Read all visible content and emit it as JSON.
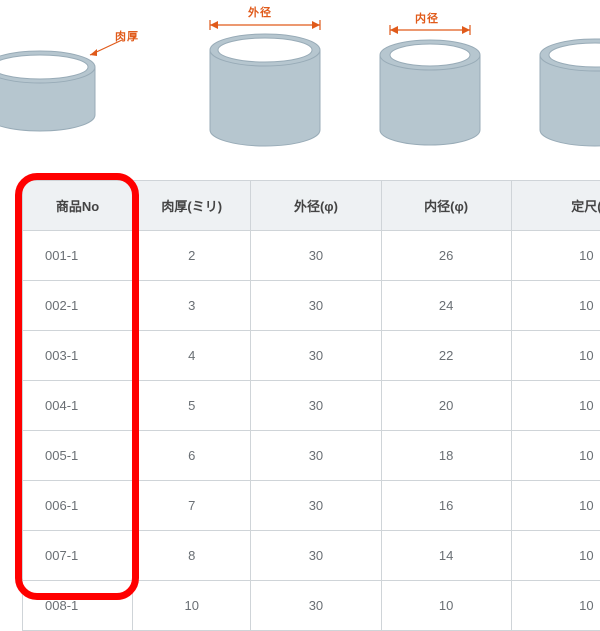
{
  "illustration": {
    "labels": {
      "nikuatsu": "肉厚",
      "gaikei": "外径",
      "naikei": "内径"
    }
  },
  "table": {
    "headers": {
      "product_no": "商品No",
      "thickness": "肉厚(ミリ)",
      "outer_dia": "外径(φ)",
      "inner_dia": "内径(φ)",
      "fixed_len": "定尺("
    },
    "rows": [
      {
        "no": "001-1",
        "thickness": "2",
        "outer": "30",
        "inner": "26",
        "fixed": "10"
      },
      {
        "no": "002-1",
        "thickness": "3",
        "outer": "30",
        "inner": "24",
        "fixed": "10"
      },
      {
        "no": "003-1",
        "thickness": "4",
        "outer": "30",
        "inner": "22",
        "fixed": "10"
      },
      {
        "no": "004-1",
        "thickness": "5",
        "outer": "30",
        "inner": "20",
        "fixed": "10"
      },
      {
        "no": "005-1",
        "thickness": "6",
        "outer": "30",
        "inner": "18",
        "fixed": "10"
      },
      {
        "no": "006-1",
        "thickness": "7",
        "outer": "30",
        "inner": "16",
        "fixed": "10"
      },
      {
        "no": "007-1",
        "thickness": "8",
        "outer": "30",
        "inner": "14",
        "fixed": "10"
      },
      {
        "no": "008-1",
        "thickness": "10",
        "outer": "30",
        "inner": "10",
        "fixed": "10"
      }
    ]
  }
}
